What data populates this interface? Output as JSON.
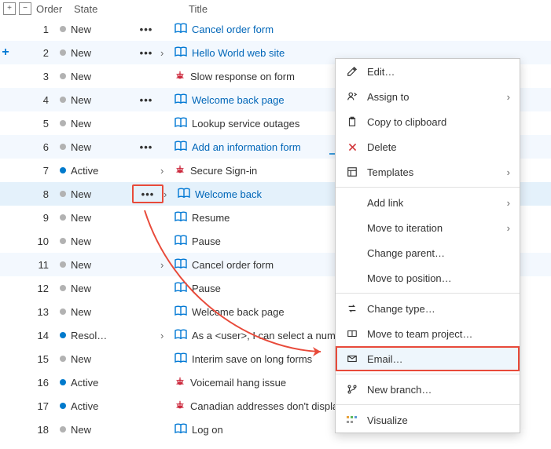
{
  "columns": {
    "order": "Order",
    "state": "State",
    "title": "Title"
  },
  "rows": [
    {
      "n": 1,
      "state": "New",
      "title": "Cancel order form",
      "kind": "book",
      "link": true,
      "alt": false,
      "more": true,
      "chev": false
    },
    {
      "n": 2,
      "state": "New",
      "title": "Hello World web site",
      "kind": "book",
      "link": true,
      "alt": true,
      "more": true,
      "chev": true,
      "plus": true
    },
    {
      "n": 3,
      "state": "New",
      "title": "Slow response on form",
      "kind": "bug",
      "link": false,
      "alt": false,
      "more": false,
      "chev": false
    },
    {
      "n": 4,
      "state": "New",
      "title": "Welcome back page",
      "kind": "book",
      "link": true,
      "alt": true,
      "more": true,
      "chev": false
    },
    {
      "n": 5,
      "state": "New",
      "title": "Lookup service outages",
      "kind": "book",
      "link": false,
      "alt": false,
      "more": false,
      "chev": false
    },
    {
      "n": 6,
      "state": "New",
      "title": "Add an information form",
      "kind": "book",
      "link": true,
      "alt": true,
      "more": true,
      "chev": false
    },
    {
      "n": 7,
      "state": "Active",
      "title": "Secure Sign-in",
      "kind": "bug",
      "link": false,
      "alt": false,
      "more": false,
      "chev": true
    },
    {
      "n": 8,
      "state": "New",
      "title": "Welcome back",
      "kind": "book",
      "link": true,
      "alt": true,
      "more": "boxed",
      "chev": true
    },
    {
      "n": 9,
      "state": "New",
      "title": "Resume",
      "kind": "book",
      "link": false,
      "alt": false,
      "more": false,
      "chev": false
    },
    {
      "n": 10,
      "state": "New",
      "title": "Pause",
      "kind": "book",
      "link": false,
      "alt": false,
      "more": false,
      "chev": false
    },
    {
      "n": 11,
      "state": "New",
      "title": "Cancel order form",
      "kind": "book",
      "link": false,
      "alt": true,
      "more": false,
      "chev": true
    },
    {
      "n": 12,
      "state": "New",
      "title": "Pause",
      "kind": "book",
      "link": false,
      "alt": false,
      "more": false,
      "chev": false
    },
    {
      "n": 13,
      "state": "New",
      "title": "Welcome back page",
      "kind": "book",
      "link": false,
      "alt": false,
      "more": false,
      "chev": false
    },
    {
      "n": 14,
      "state": "Resol…",
      "title": "As a  <user>, I can select a numbe",
      "kind": "book",
      "link": false,
      "alt": false,
      "more": false,
      "chev": true
    },
    {
      "n": 15,
      "state": "New",
      "title": "Interim save on long forms",
      "kind": "book",
      "link": false,
      "alt": false,
      "more": false,
      "chev": false
    },
    {
      "n": 16,
      "state": "Active",
      "title": "Voicemail hang issue",
      "kind": "bug",
      "link": false,
      "alt": false,
      "more": false,
      "chev": false
    },
    {
      "n": 17,
      "state": "Active",
      "title": "Canadian addresses don't display",
      "kind": "bug",
      "link": false,
      "alt": false,
      "more": false,
      "chev": false
    },
    {
      "n": 18,
      "state": "New",
      "title": "Log on",
      "kind": "book",
      "link": false,
      "alt": false,
      "more": false,
      "chev": false
    }
  ],
  "menu": {
    "edit": "Edit…",
    "assign": "Assign to",
    "copy": "Copy to clipboard",
    "delete": "Delete",
    "templates": "Templates",
    "addlink": "Add link",
    "moveiter": "Move to iteration",
    "changeparent": "Change parent…",
    "movepos": "Move to position…",
    "changetype": "Change type…",
    "moveteam": "Move to team project…",
    "email": "Email…",
    "newbranch": "New branch…",
    "visualize": "Visualize"
  }
}
